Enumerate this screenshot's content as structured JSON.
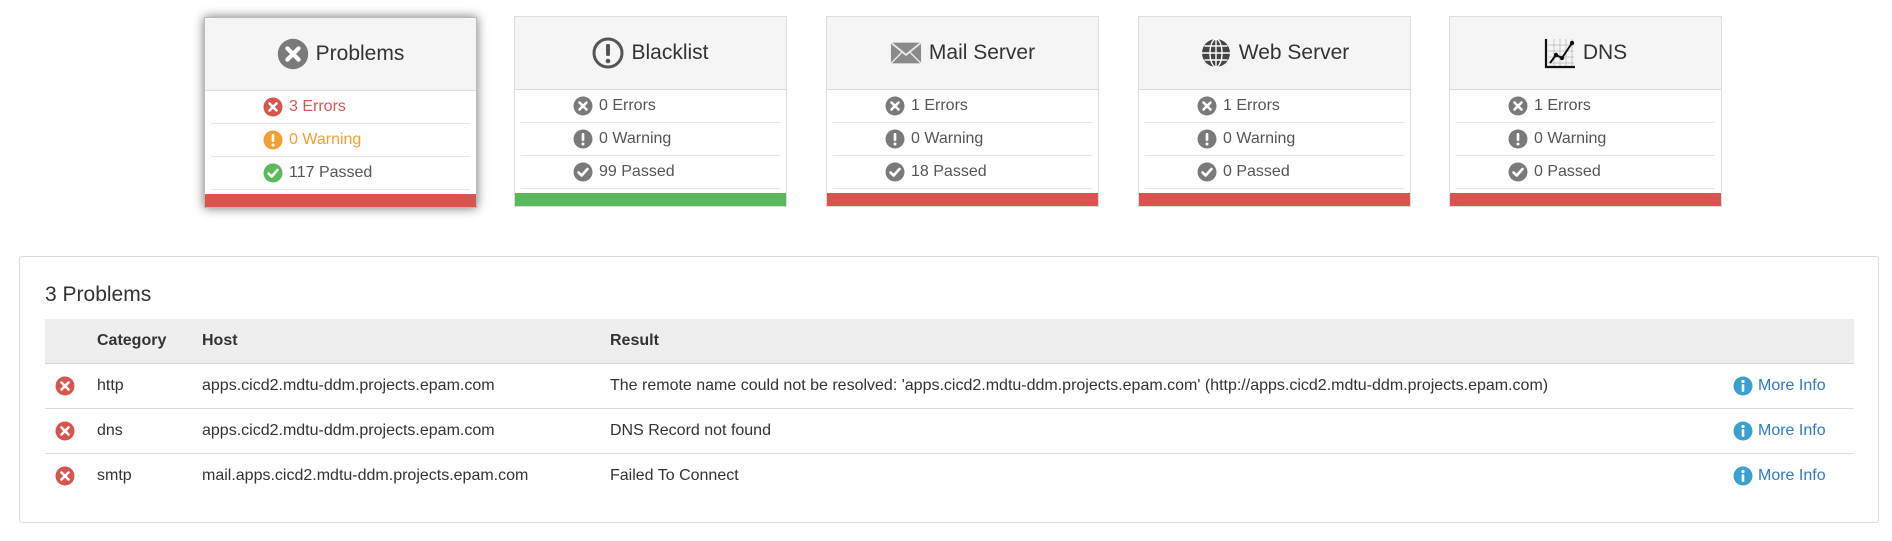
{
  "cards": [
    {
      "title": "Problems",
      "icon": "x-circle-icon",
      "bar_color": "#d9534f",
      "errors": "3 Errors",
      "warnings": "0 Warning",
      "passed": "117 Passed"
    },
    {
      "title": "Blacklist",
      "icon": "exclamation-circle-icon",
      "bar_color": "#5cb85c",
      "errors": "0 Errors",
      "warnings": "0 Warning",
      "passed": "99 Passed"
    },
    {
      "title": "Mail Server",
      "icon": "envelope-icon",
      "bar_color": "#d9534f",
      "errors": "1 Errors",
      "warnings": "0 Warning",
      "passed": "18 Passed"
    },
    {
      "title": "Web Server",
      "icon": "globe-icon",
      "bar_color": "#d9534f",
      "errors": "1 Errors",
      "warnings": "0 Warning",
      "passed": "0 Passed"
    },
    {
      "title": "DNS",
      "icon": "network-chart-icon",
      "bar_color": "#d9534f",
      "errors": "1 Errors",
      "warnings": "0 Warning",
      "passed": "0 Passed"
    }
  ],
  "colors": {
    "error": "#d9534f",
    "warning": "#f0a030",
    "passed": "#5cb85c",
    "muted": "#7a7a7a",
    "info": "#39a0d0",
    "link": "#2f7bbf"
  },
  "problems": {
    "title": "3 Problems",
    "columns": {
      "category": "Category",
      "host": "Host",
      "result": "Result"
    },
    "rows": [
      {
        "category": "http",
        "host": "apps.cicd2.mdtu-ddm.projects.epam.com",
        "result": "The remote name could not be resolved: 'apps.cicd2.mdtu-ddm.projects.epam.com' (http://apps.cicd2.mdtu-ddm.projects.epam.com)",
        "more": "More Info"
      },
      {
        "category": "dns",
        "host": "apps.cicd2.mdtu-ddm.projects.epam.com",
        "result": "DNS Record not found",
        "more": "More Info"
      },
      {
        "category": "smtp",
        "host": "mail.apps.cicd2.mdtu-ddm.projects.epam.com",
        "result": "Failed To Connect",
        "more": "More Info"
      }
    ]
  }
}
